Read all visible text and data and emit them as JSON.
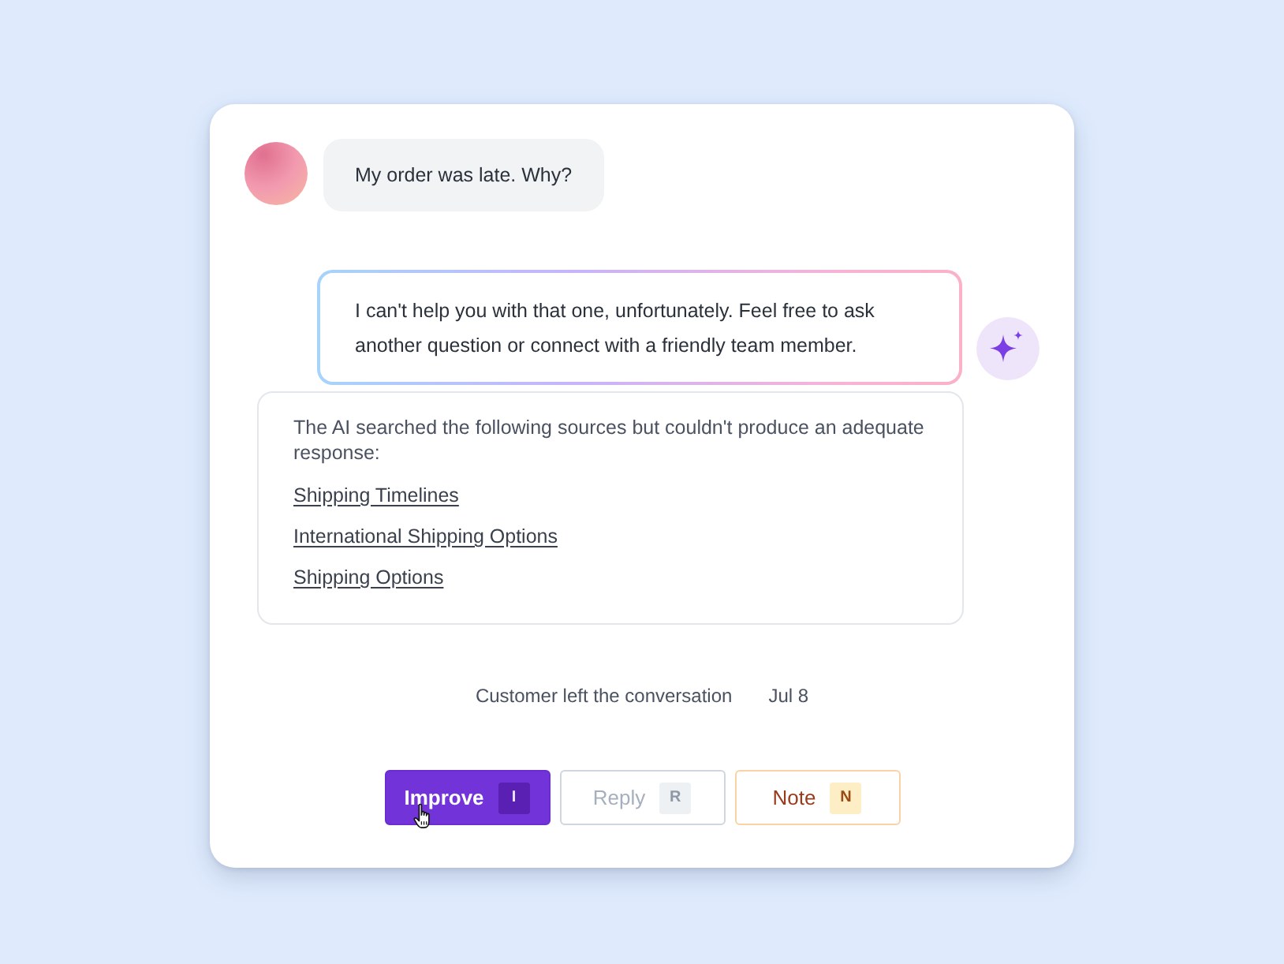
{
  "customer_message": {
    "text": "My order was late. Why?"
  },
  "ai_reply": {
    "text": "I can't help you with that one, unfortunately. Feel free to ask another question or connect with a friendly team member."
  },
  "sources_panel": {
    "intro": "The AI searched the following sources but couldn't produce an adequate response:",
    "links": [
      "Shipping Timelines",
      "International Shipping Options",
      "Shipping Options"
    ]
  },
  "event": {
    "text": "Customer left the conversation",
    "date": "Jul 8"
  },
  "actions": [
    {
      "kind": "primary",
      "label": "Improve",
      "shortcut": "I"
    },
    {
      "kind": "muted",
      "label": "Reply",
      "shortcut": "R"
    },
    {
      "kind": "note",
      "label": "Note",
      "shortcut": "N"
    }
  ]
}
